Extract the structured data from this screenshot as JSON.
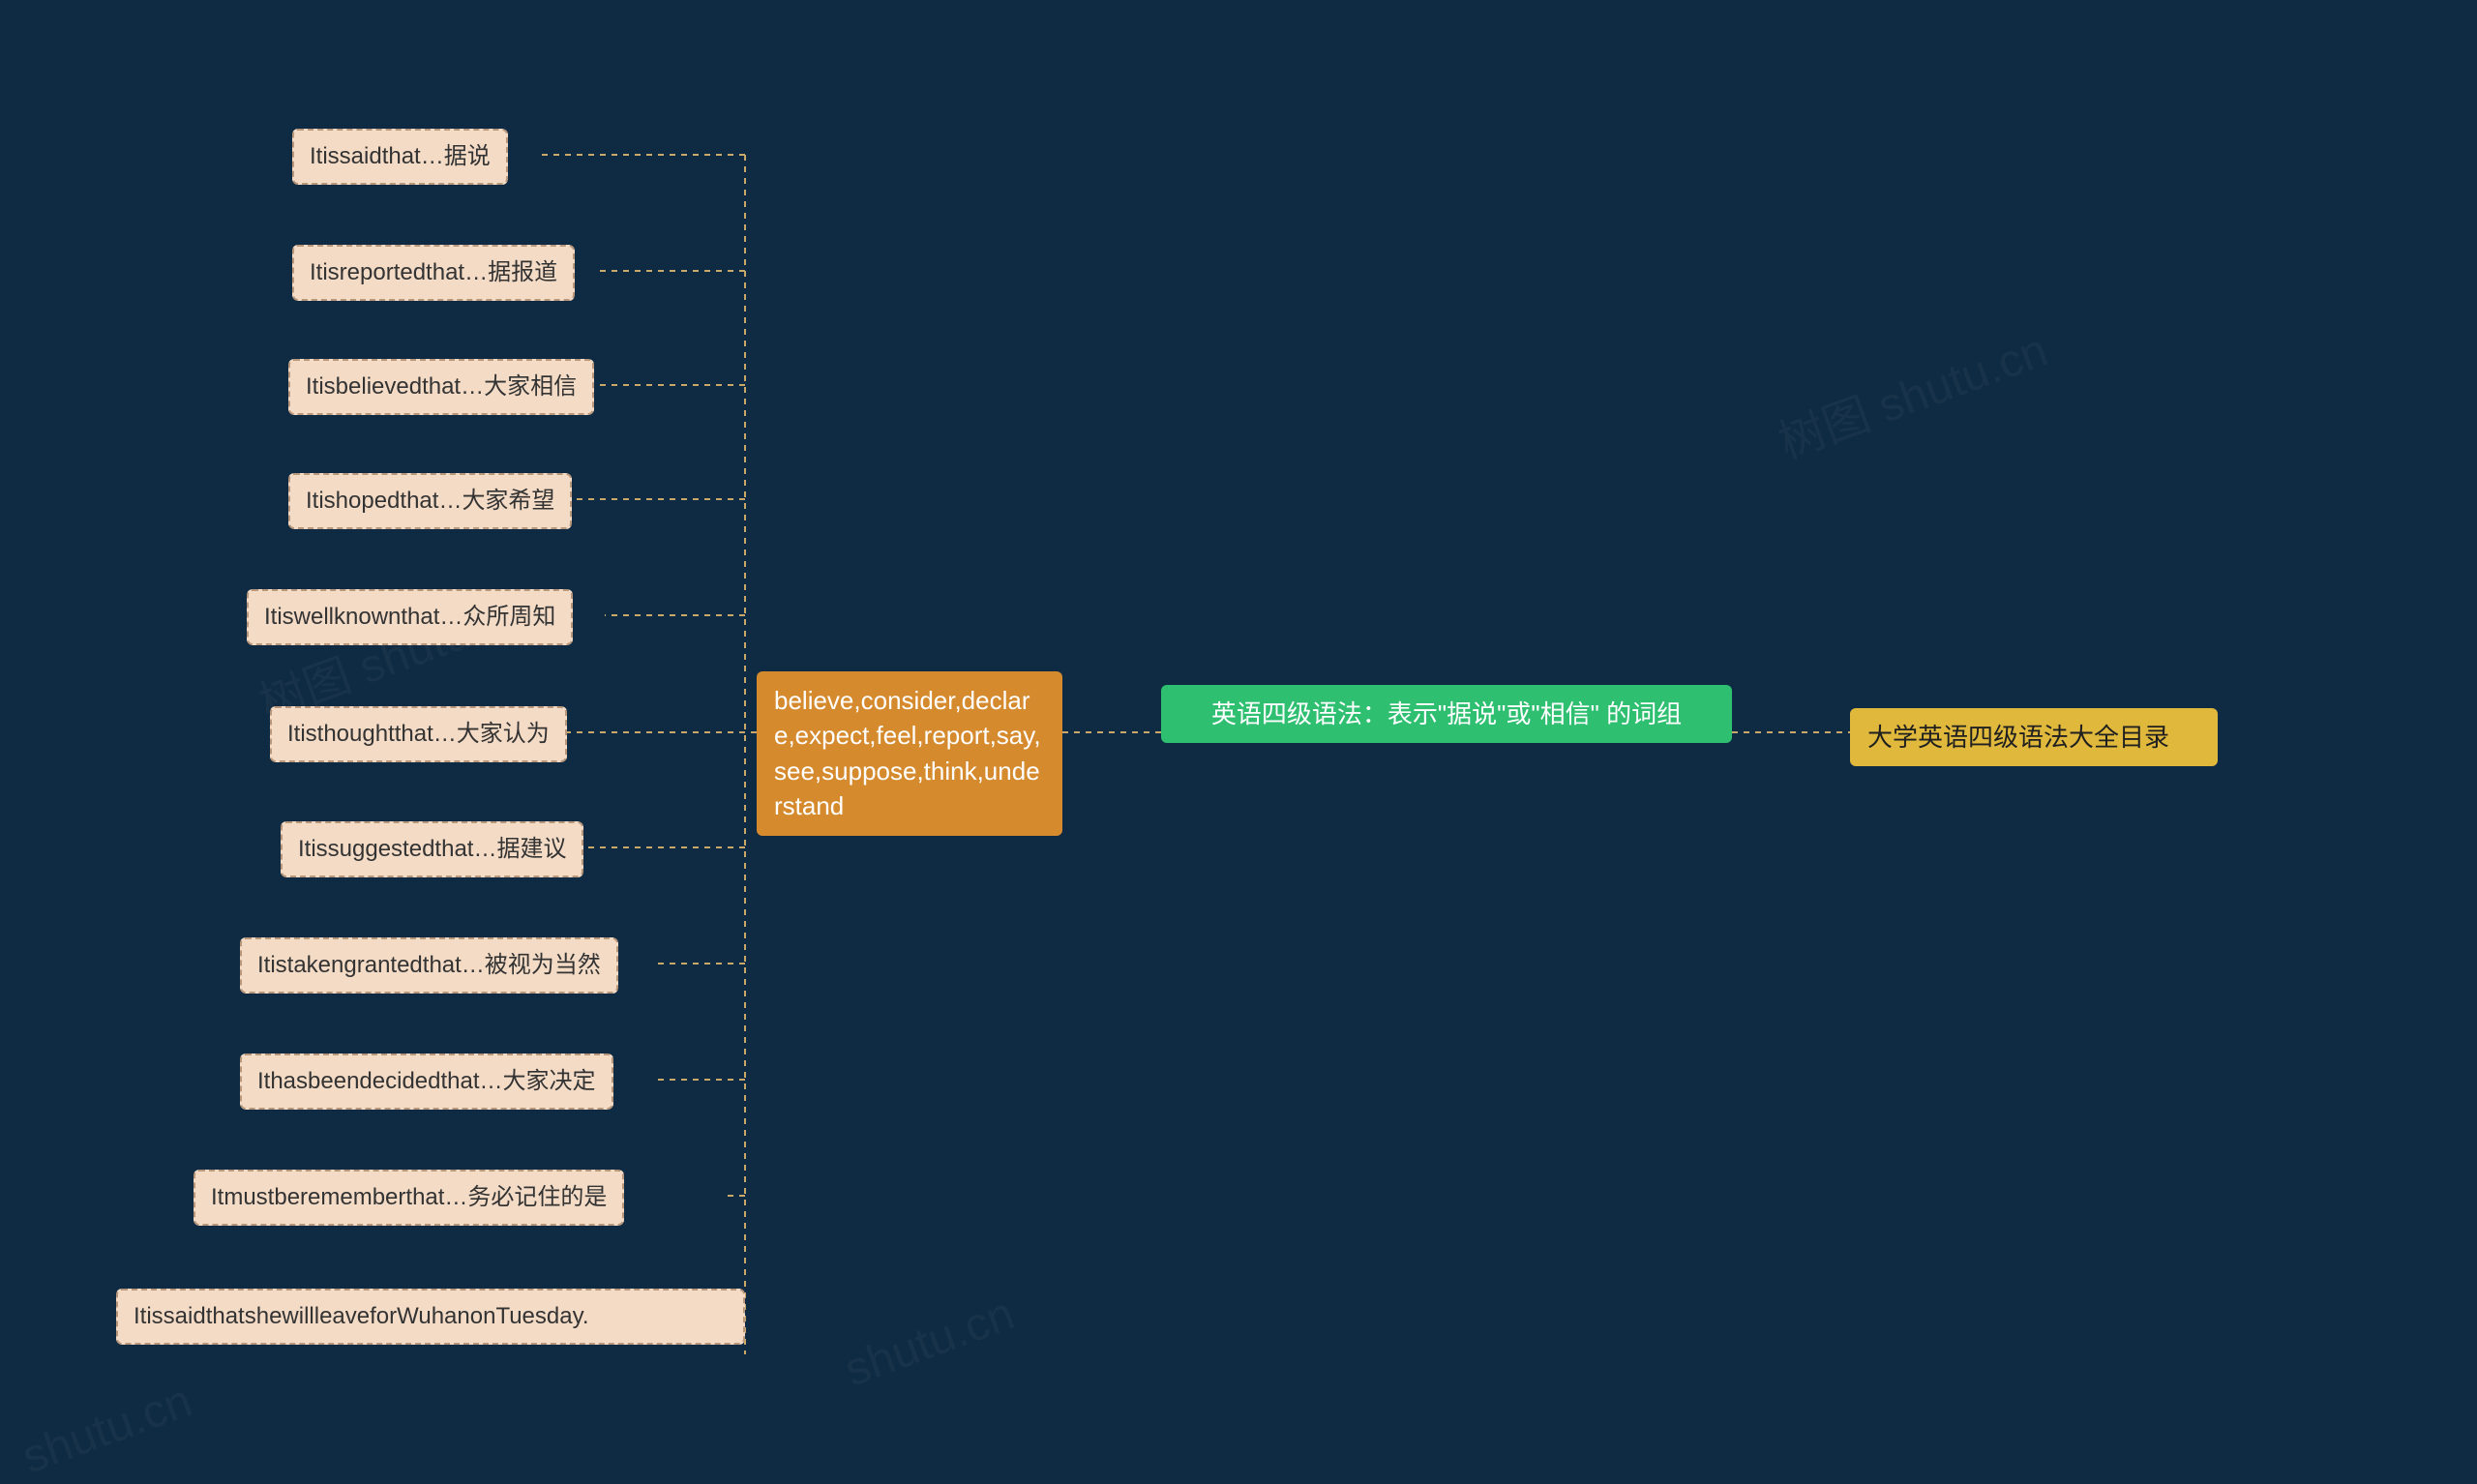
{
  "root": {
    "title": "英语四级语法：表示\"据说\"或\"相信\" 的词组"
  },
  "right_node": {
    "label": "大学英语四级语法大全目录"
  },
  "middle_node": {
    "label": "believe,consider,declare,expect,feel,report,say,see,suppose,think,understand"
  },
  "leaves": [
    {
      "label": "Itissaidthat…据说"
    },
    {
      "label": "Itisreportedthat…据报道"
    },
    {
      "label": "Itisbelievedthat…大家相信"
    },
    {
      "label": "Itishopedthat…大家希望"
    },
    {
      "label": "Itiswellknownthat…众所周知"
    },
    {
      "label": "Itisthoughtthat…大家认为"
    },
    {
      "label": "Itissuggestedthat…据建议"
    },
    {
      "label": "Itistakengrantedthat…被视为当然"
    },
    {
      "label": "Ithasbeendecidedthat…大家决定"
    },
    {
      "label": "Itmustberememberthat…务必记住的是"
    },
    {
      "label": "ItissaidthatshewillleaveforWuhanonTuesday."
    }
  ],
  "watermarks": [
    "树图 shutu.cn",
    "树图 shutu.cn",
    "shutu.cn",
    "shutu.cn"
  ],
  "chart_data": {
    "type": "mindmap",
    "root": "英语四级语法：表示\"据说\"或\"相信\" 的词组",
    "branches": [
      {
        "side": "right",
        "label": "大学英语四级语法大全目录",
        "children": []
      },
      {
        "side": "left",
        "label": "believe,consider,declare,expect,feel,report,say,see,suppose,think,understand",
        "children": [
          "Itissaidthat…据说",
          "Itisreportedthat…据报道",
          "Itisbelievedthat…大家相信",
          "Itishopedthat…大家希望",
          "Itiswellknownthat…众所周知",
          "Itisthoughtthat…大家认为",
          "Itissuggestedthat…据建议",
          "Itistakengrantedthat…被视为当然",
          "Ithasbeendecidedthat…大家决定",
          "Itmustberememberthat…务必记住的是",
          "ItissaidthatshewillleaveforWuhanonTuesday."
        ]
      }
    ]
  }
}
